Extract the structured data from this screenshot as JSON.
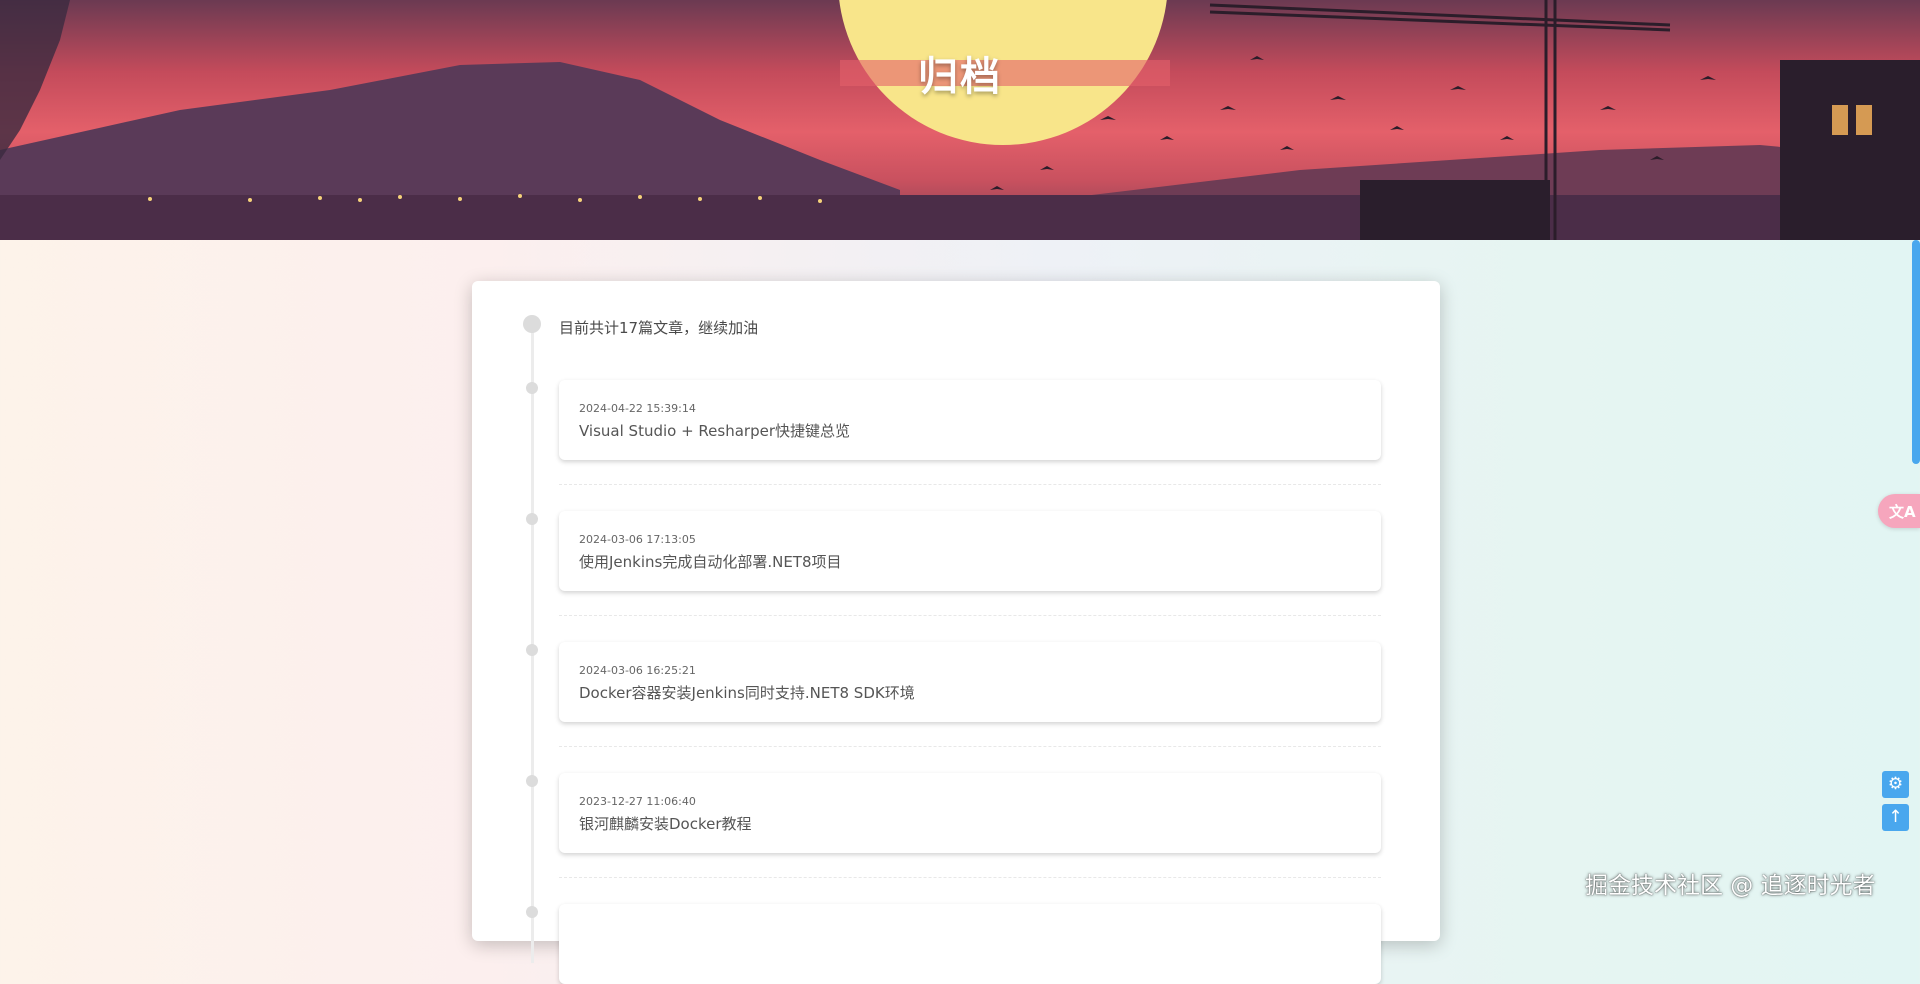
{
  "hero": {
    "title": "归档"
  },
  "archive": {
    "count_text": "目前共计17篇文章，继续加油",
    "posts": [
      {
        "date": "2024-04-22 15:39:14",
        "title": "Visual Studio + Resharper快捷键总览"
      },
      {
        "date": "2024-03-06 17:13:05",
        "title": "使用Jenkins完成自动化部署.NET8项目"
      },
      {
        "date": "2024-03-06 16:25:21",
        "title": "Docker容器安装Jenkins同时支持.NET8 SDK环境"
      },
      {
        "date": "2023-12-27 11:06:40",
        "title": "银河麒麟安装Docker教程"
      }
    ]
  },
  "side": {
    "translate_icon": "translate-icon",
    "settings_icon": "gear-icon",
    "top_icon": "arrow-up-icon"
  },
  "watermark": "掘金技术社区 @ 追逐时光者",
  "colors": {
    "accent": "#49a7ee",
    "translate": "#f6a6bd"
  }
}
